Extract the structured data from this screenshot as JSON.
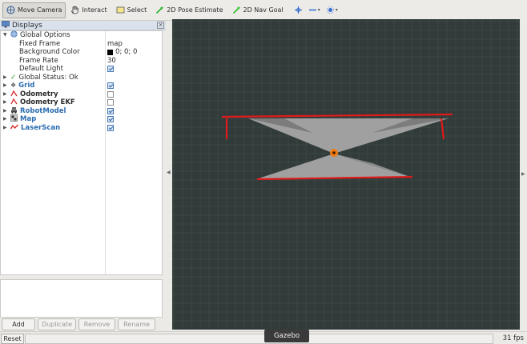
{
  "toolbar": {
    "move_camera": "Move Camera",
    "interact": "Interact",
    "select": "Select",
    "pose_estimate": "2D Pose Estimate",
    "nav_goal": "2D Nav Goal"
  },
  "displays": {
    "title": "Displays",
    "global_options": {
      "label": "Global Options",
      "fixed_frame_label": "Fixed Frame",
      "fixed_frame_value": "map",
      "background_color_label": "Background Color",
      "background_color_value": "0; 0; 0",
      "frame_rate_label": "Frame Rate",
      "frame_rate_value": "30",
      "default_light_label": "Default Light"
    },
    "global_status": "Global Status: Ok",
    "items": [
      {
        "label": "Grid",
        "checked": true
      },
      {
        "label": "Odometry",
        "checked": false
      },
      {
        "label": "Odometry EKF",
        "checked": false
      },
      {
        "label": "RobotModel",
        "checked": true
      },
      {
        "label": "Map",
        "checked": true
      },
      {
        "label": "LaserScan",
        "checked": true
      }
    ],
    "buttons": {
      "add": "Add",
      "duplicate": "Duplicate",
      "remove": "Remove",
      "rename": "Rename"
    }
  },
  "status": {
    "reset": "Reset",
    "fps": "31 fps"
  },
  "tooltip": "Gazebo",
  "colors": {
    "viewport_bg": "#313b39",
    "grid_line": "#4a5452",
    "laser": "#e01b1b",
    "map_fill": "#9a9a9a",
    "robot": "#f07a10",
    "link_blue": "#2b6cb0"
  }
}
